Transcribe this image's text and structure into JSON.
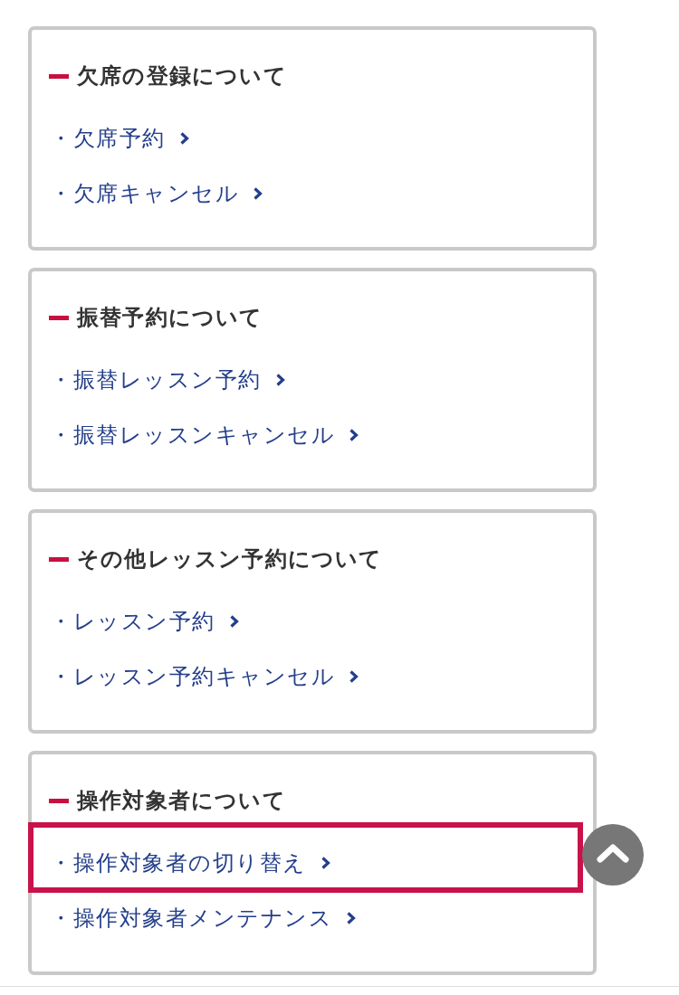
{
  "sections": [
    {
      "title": "欠席の登録について",
      "items": [
        {
          "label": "・欠席予約",
          "highlighted": false
        },
        {
          "label": "・欠席キャンセル",
          "highlighted": false
        }
      ]
    },
    {
      "title": "振替予約について",
      "items": [
        {
          "label": "・振替レッスン予約",
          "highlighted": false
        },
        {
          "label": "・振替レッスンキャンセル",
          "highlighted": false
        }
      ]
    },
    {
      "title": "その他レッスン予約について",
      "items": [
        {
          "label": "・レッスン予約",
          "highlighted": false
        },
        {
          "label": "・レッスン予約キャンセル",
          "highlighted": false
        }
      ]
    },
    {
      "title": "操作対象者について",
      "items": [
        {
          "label": "・操作対象者の切り替え",
          "highlighted": true
        },
        {
          "label": "・操作対象者メンテナンス",
          "highlighted": false
        }
      ]
    }
  ]
}
